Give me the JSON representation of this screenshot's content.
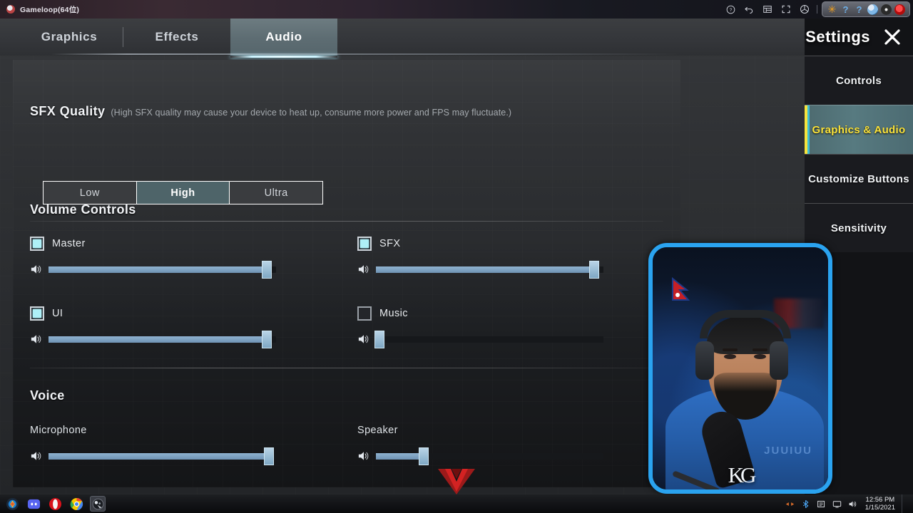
{
  "window": {
    "app_title": "Gameloop(64位)",
    "app_icon": "gameloop-icon",
    "controls": [
      {
        "name": "help-icon",
        "glyph": "?"
      },
      {
        "name": "back-icon",
        "glyph": "back"
      },
      {
        "name": "keyboard-mapping-icon",
        "glyph": "grid"
      },
      {
        "name": "fullscreen-icon",
        "glyph": "expand"
      },
      {
        "name": "multi-instance-icon",
        "glyph": "circle"
      },
      {
        "name": "pin-icon",
        "glyph": "pin"
      },
      {
        "name": "menu-icon",
        "glyph": "hamburger"
      },
      {
        "name": "minimize-icon",
        "glyph": "minimize"
      },
      {
        "name": "maximize-icon",
        "glyph": "maximize"
      },
      {
        "name": "close-icon",
        "glyph": "close"
      }
    ],
    "floating_toolbar": [
      "star-icon",
      "question-icon",
      "question-icon",
      "globe-icon",
      "obs-icon",
      "opera-icon"
    ]
  },
  "tabs": [
    {
      "label": "Graphics",
      "selected": false
    },
    {
      "label": "Effects",
      "selected": false
    },
    {
      "label": "Audio",
      "selected": true
    }
  ],
  "sfx_quality": {
    "title": "SFX Quality",
    "note": "(High SFX quality may cause your device to heat up, consume more power and FPS may fluctuate.)",
    "options": [
      {
        "label": "Low",
        "selected": false
      },
      {
        "label": "High",
        "selected": true
      },
      {
        "label": "Ultra",
        "selected": false
      }
    ]
  },
  "volume_controls": {
    "title": "Volume Controls",
    "items": [
      {
        "label": "Master",
        "checked": true,
        "value": 96,
        "icon": "speaker-icon"
      },
      {
        "label": "SFX",
        "checked": true,
        "value": 96,
        "icon": "speaker-icon"
      },
      {
        "label": "UI",
        "checked": true,
        "value": 96,
        "icon": "speaker-icon"
      },
      {
        "label": "Music",
        "checked": false,
        "value": 1,
        "icon": "speaker-icon"
      }
    ]
  },
  "voice": {
    "title": "Voice",
    "items": [
      {
        "label": "Microphone",
        "value": 97,
        "icon": "speaker-icon"
      },
      {
        "label": "Speaker",
        "value": 21,
        "icon": "speaker-icon"
      }
    ]
  },
  "settings_panel": {
    "title": "Settings",
    "close_icon": "close-icon",
    "items": [
      {
        "label": "Controls",
        "selected": false
      },
      {
        "label": "Graphics & Audio",
        "selected": true
      },
      {
        "label": "Customize Buttons",
        "selected": false
      },
      {
        "label": "Sensitivity",
        "selected": false
      }
    ]
  },
  "webcam": {
    "logo": "KG",
    "shirt_text": "JUUIUU"
  },
  "taskbar": {
    "icons": [
      "start-icon",
      "discord-icon",
      "opera-icon",
      "chrome-icon",
      "gameloop-icon"
    ],
    "tray_icons": [
      "network-icon",
      "bluetooth-icon",
      "app-icon",
      "display-icon",
      "volume-icon"
    ],
    "time": "12:56 PM",
    "date": "1/15/2021"
  },
  "colors": {
    "accent_selected": "#fbe33a",
    "slider_fill": "#7ea7c4",
    "checkbox_on": "#aef0f7",
    "tab_selected_bg": "#5d6c72",
    "cam_border": "#2aa3f0"
  }
}
